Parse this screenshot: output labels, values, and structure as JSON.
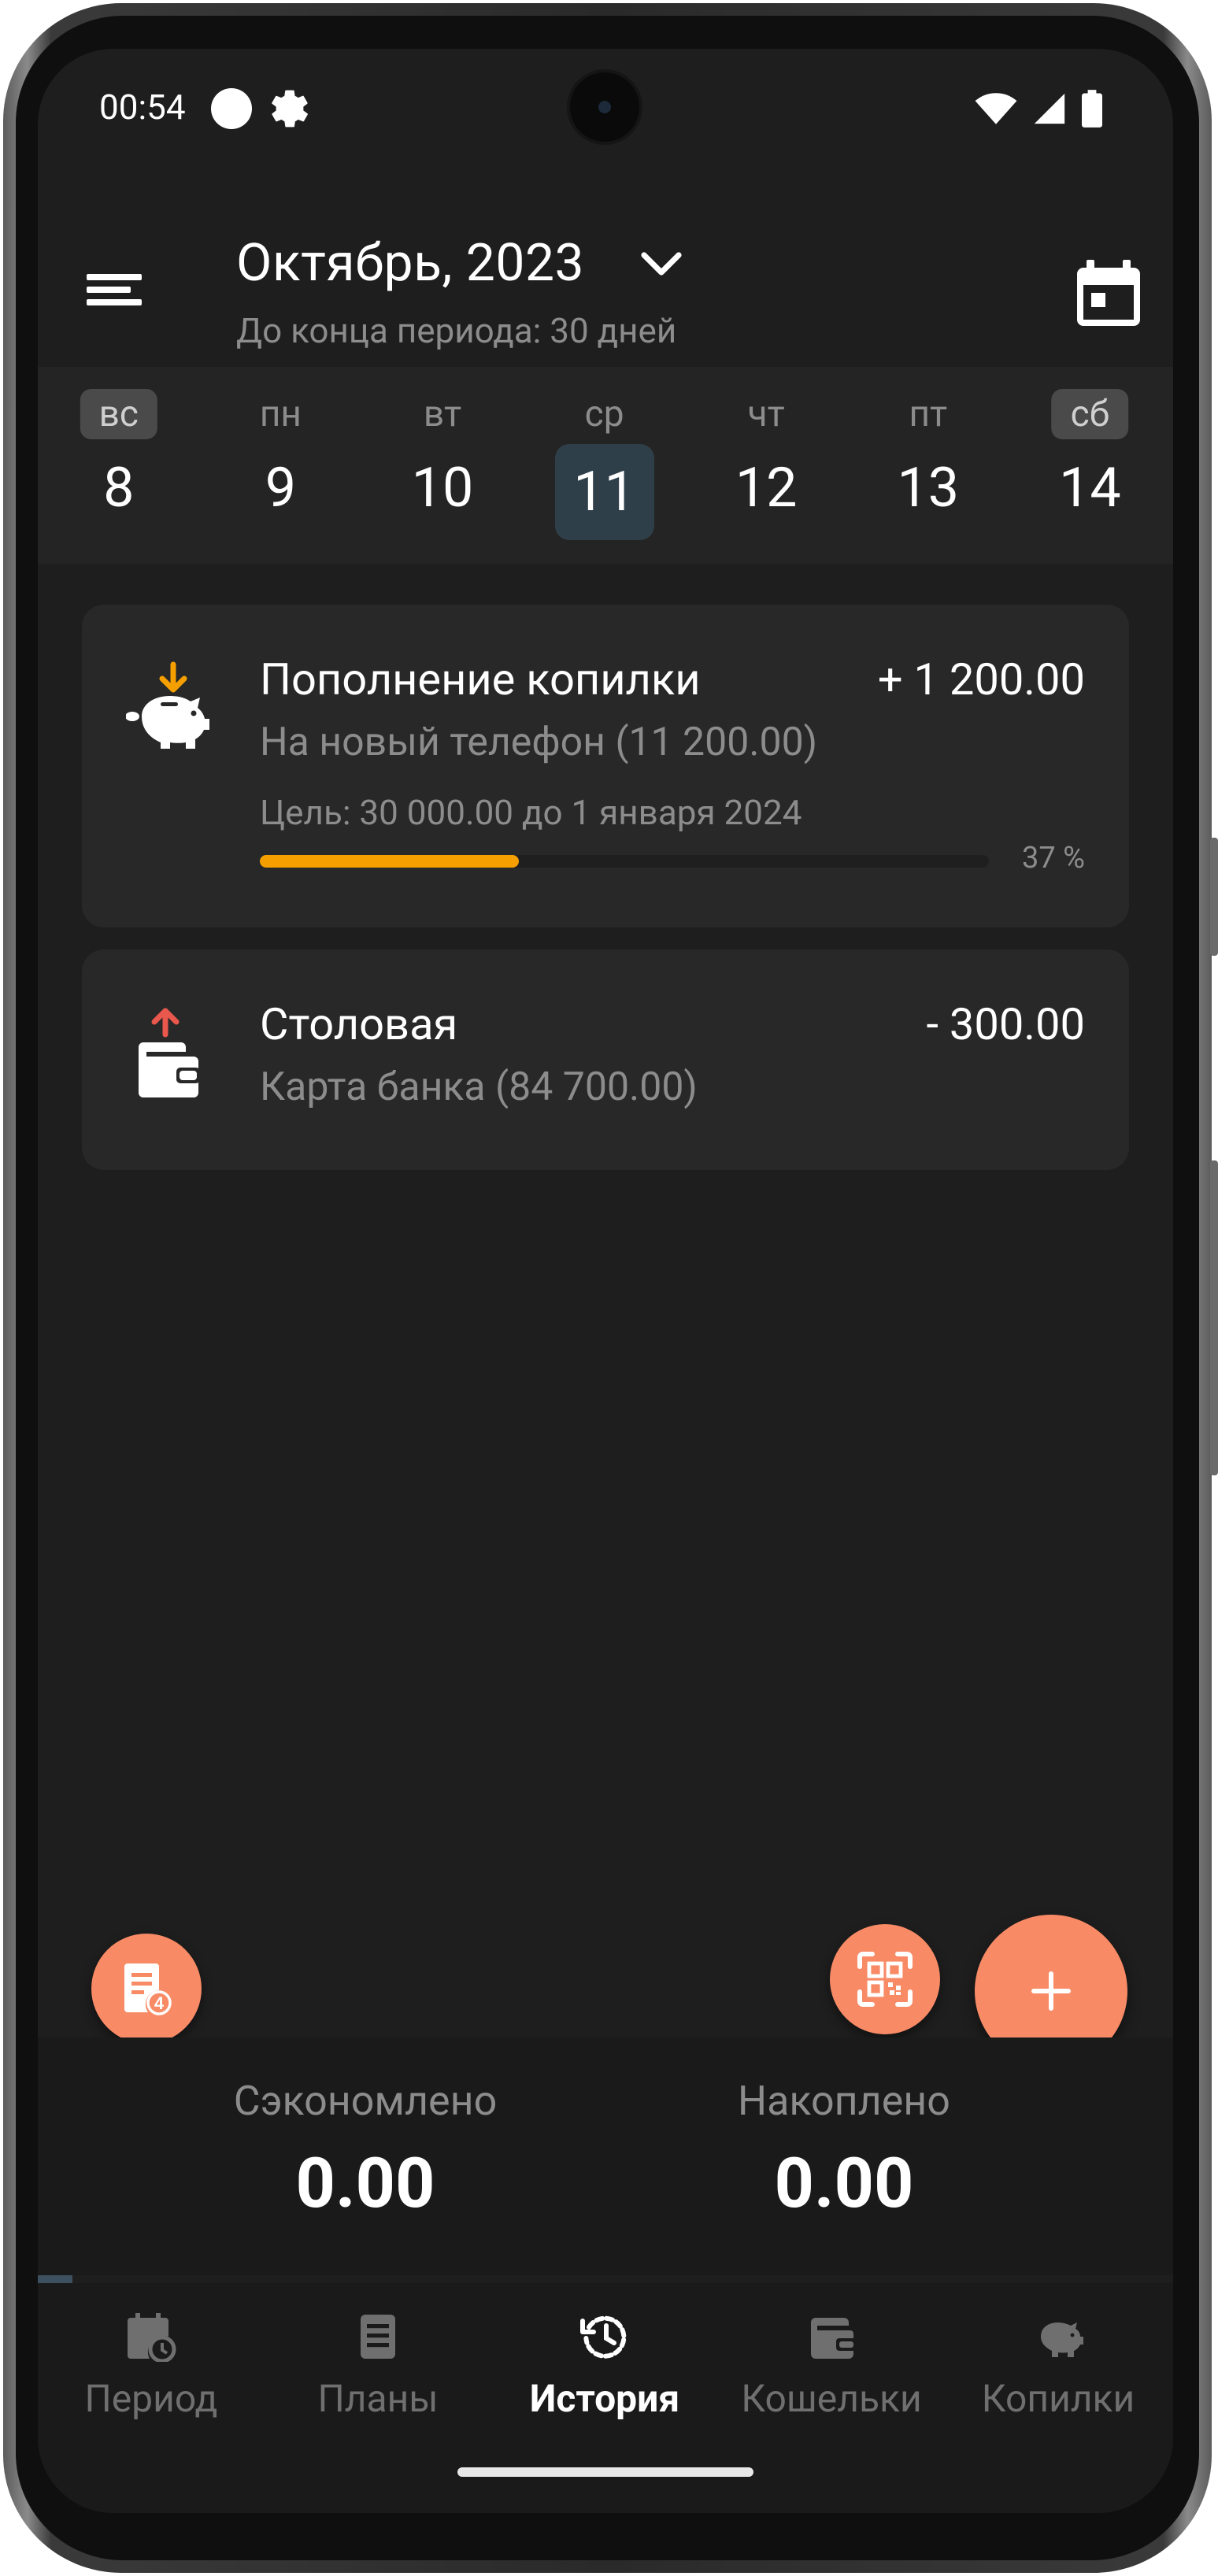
{
  "status_bar": {
    "time": "00:54",
    "icons": [
      "circle-icon",
      "gear-icon",
      "wifi-icon",
      "cellular-signal-icon",
      "battery-icon"
    ]
  },
  "header": {
    "title": "Октябрь, 2023",
    "subtitle": "До конца периода: 30 дней",
    "menu_icon": "menu-icon",
    "calendar_icon": "calendar-icon"
  },
  "week": [
    {
      "name": "вс",
      "num": "8",
      "weekend": true,
      "selected": false
    },
    {
      "name": "пн",
      "num": "9",
      "weekend": false,
      "selected": false
    },
    {
      "name": "вт",
      "num": "10",
      "weekend": false,
      "selected": false
    },
    {
      "name": "ср",
      "num": "11",
      "weekend": false,
      "selected": true
    },
    {
      "name": "чт",
      "num": "12",
      "weekend": false,
      "selected": false
    },
    {
      "name": "пт",
      "num": "13",
      "weekend": false,
      "selected": false
    },
    {
      "name": "сб",
      "num": "14",
      "weekend": true,
      "selected": false
    }
  ],
  "transactions": [
    {
      "title": "Пополнение копилки",
      "amount": "+ 1 200.00",
      "subtitle": "На новый телефон  (11 200.00)",
      "goal": "Цель: 30 000.00 до 1 января 2024",
      "progress_percent": 37,
      "progress_label": "37 %",
      "icon": "piggy-bank-deposit-icon",
      "arrow_color": "#f5a000"
    },
    {
      "title": "Столовая",
      "amount": "- 300.00",
      "subtitle": "Карта банка  (84 700.00)",
      "icon": "wallet-expense-icon",
      "arrow_color": "#e9574d"
    }
  ],
  "fabs": {
    "receipts_badge": "4",
    "add_label": "+"
  },
  "summary": {
    "saved_label": "Сэкономлено",
    "saved_value": "0.00",
    "accumulated_label": "Накоплено",
    "accumulated_value": "0.00"
  },
  "nav": [
    {
      "label": "Период",
      "icon": "calendar-clock-icon",
      "active": false
    },
    {
      "label": "Планы",
      "icon": "list-icon",
      "active": false
    },
    {
      "label": "История",
      "icon": "history-icon",
      "active": true
    },
    {
      "label": "Кошельки",
      "icon": "wallet-icon",
      "active": false
    },
    {
      "label": "Копилки",
      "icon": "piggy-bank-icon",
      "active": false
    }
  ],
  "colors": {
    "accent": "#f88a66",
    "progress": "#f5a000",
    "expense_arrow": "#e9574d",
    "selected_day": "#2f3f4a"
  }
}
